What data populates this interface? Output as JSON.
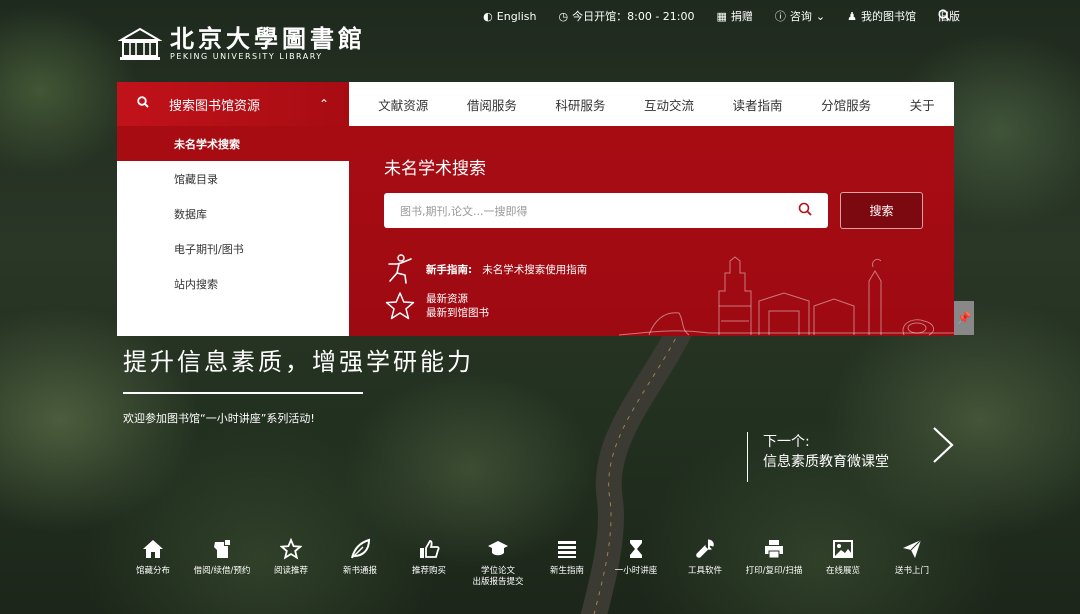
{
  "topbar": {
    "english": "English",
    "hours": "今日开馆：8:00 - 21:00",
    "donate": "捐赠",
    "consult": "咨询",
    "my_library": "我的图书馆",
    "old_version": "旧版"
  },
  "logo": {
    "zh": "北京大學圖書館",
    "en": "PEKING UNIVERSITY LIBRARY"
  },
  "nav": {
    "search_label": "搜索图书馆资源",
    "items": [
      "文献资源",
      "借阅服务",
      "科研服务",
      "互动交流",
      "读者指南",
      "分馆服务",
      "关于"
    ]
  },
  "side_menu": [
    "未名学术搜索",
    "馆藏目录",
    "数据库",
    "电子期刊/图书",
    "站内搜索"
  ],
  "panel": {
    "title": "未名学术搜索",
    "placeholder": "图书,期刊,论文...一搜即得",
    "search_button": "搜索",
    "guide_label": "新手指南:",
    "guide_text": "未名学术搜索使用指南",
    "new_res_1": "最新资源",
    "new_res_2": "最新到馆图书"
  },
  "hero": {
    "title": "提升信息素质，增强学研能力",
    "subtitle": "欢迎参加图书馆“一小时讲座”系列活动!",
    "next_label": "下一个:",
    "next_title": "信息素质教育微课堂"
  },
  "quick_links": [
    {
      "label": "馆藏分布",
      "icon": "home-icon"
    },
    {
      "label": "借阅/续借/预约",
      "icon": "borrow-icon"
    },
    {
      "label": "阅读推荐",
      "icon": "star-icon"
    },
    {
      "label": "新书通报",
      "icon": "leaf-icon"
    },
    {
      "label": "推荐购买",
      "icon": "thumbs-up-icon"
    },
    {
      "label": "学位论文\n出版报告提交",
      "icon": "graduation-cap-icon"
    },
    {
      "label": "新生指南",
      "icon": "list-icon"
    },
    {
      "label": "一小时讲座",
      "icon": "hourglass-icon"
    },
    {
      "label": "工具软件",
      "icon": "wrench-icon"
    },
    {
      "label": "打印/复印/扫描",
      "icon": "printer-icon"
    },
    {
      "label": "在线展览",
      "icon": "image-icon"
    },
    {
      "label": "送书上门",
      "icon": "paper-plane-icon"
    }
  ]
}
